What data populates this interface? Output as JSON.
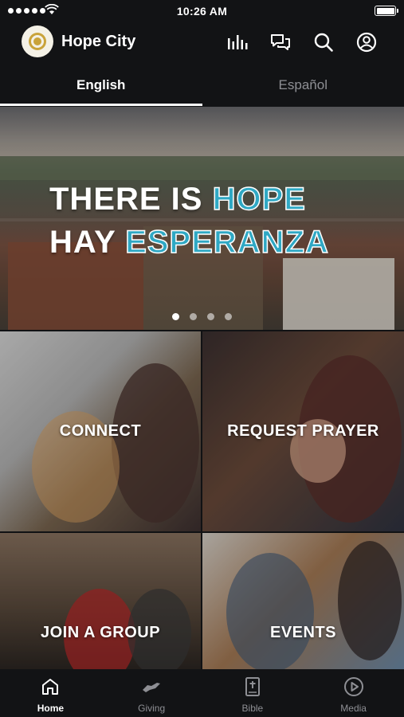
{
  "status_bar": {
    "time": "10:26 AM"
  },
  "header": {
    "app_title": "Hope City",
    "icons": [
      "bar-chart-icon",
      "chat-icon",
      "search-icon",
      "profile-icon"
    ]
  },
  "language_tabs": [
    {
      "label": "English",
      "selected": true
    },
    {
      "label": "Español",
      "selected": false
    }
  ],
  "hero": {
    "line1_part1": "THERE IS",
    "line1_part2": "HOPE",
    "line2_part1": "HAY",
    "line2_part2": "ESPERANZA",
    "slide_count": 4,
    "active_slide": 1
  },
  "tiles": [
    {
      "label": "CONNECT"
    },
    {
      "label": "REQUEST PRAYER"
    },
    {
      "label": "JOIN A GROUP"
    },
    {
      "label": "EVENTS"
    }
  ],
  "tab_bar": [
    {
      "label": "Home",
      "icon": "home-icon",
      "selected": true
    },
    {
      "label": "Giving",
      "icon": "giving-icon",
      "selected": false
    },
    {
      "label": "Bible",
      "icon": "bible-icon",
      "selected": false
    },
    {
      "label": "Media",
      "icon": "media-play-icon",
      "selected": false
    }
  ],
  "colors": {
    "accent": "#2fa8c4",
    "background": "#121315",
    "inactive": "#8e8f94"
  }
}
